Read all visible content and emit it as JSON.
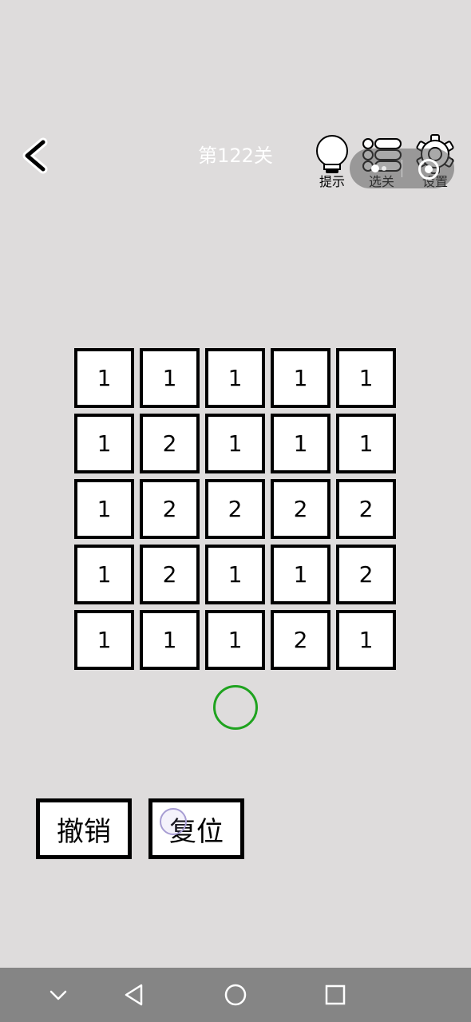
{
  "header": {
    "level_title": "第122关",
    "back_icon": "back-chevron-icon"
  },
  "toolbar": {
    "hint_label": "提示",
    "select_level_label": "选关",
    "settings_label": "设置",
    "hint_icon": "lightbulb-icon",
    "select_level_icon": "list-icon",
    "settings_icon": "gear-icon"
  },
  "board": {
    "rows": [
      [
        "1",
        "1",
        "1",
        "1",
        "1"
      ],
      [
        "1",
        "2",
        "1",
        "1",
        "1"
      ],
      [
        "1",
        "2",
        "2",
        "2",
        "2"
      ],
      [
        "1",
        "2",
        "1",
        "1",
        "2"
      ],
      [
        "1",
        "1",
        "1",
        "2",
        "1"
      ]
    ]
  },
  "indicator": {
    "color": "#1fa31f"
  },
  "actions": {
    "undo_label": "撤销",
    "reset_label": "复位"
  },
  "system_nav": {
    "icons": [
      "chevron-down-icon",
      "back-triangle-icon",
      "home-circle-icon",
      "recents-square-icon"
    ]
  },
  "colors": {
    "background": "#dedcdc",
    "cell_border": "#000000",
    "cell_fill": "#ffffff",
    "nav_bar": "#858585"
  }
}
